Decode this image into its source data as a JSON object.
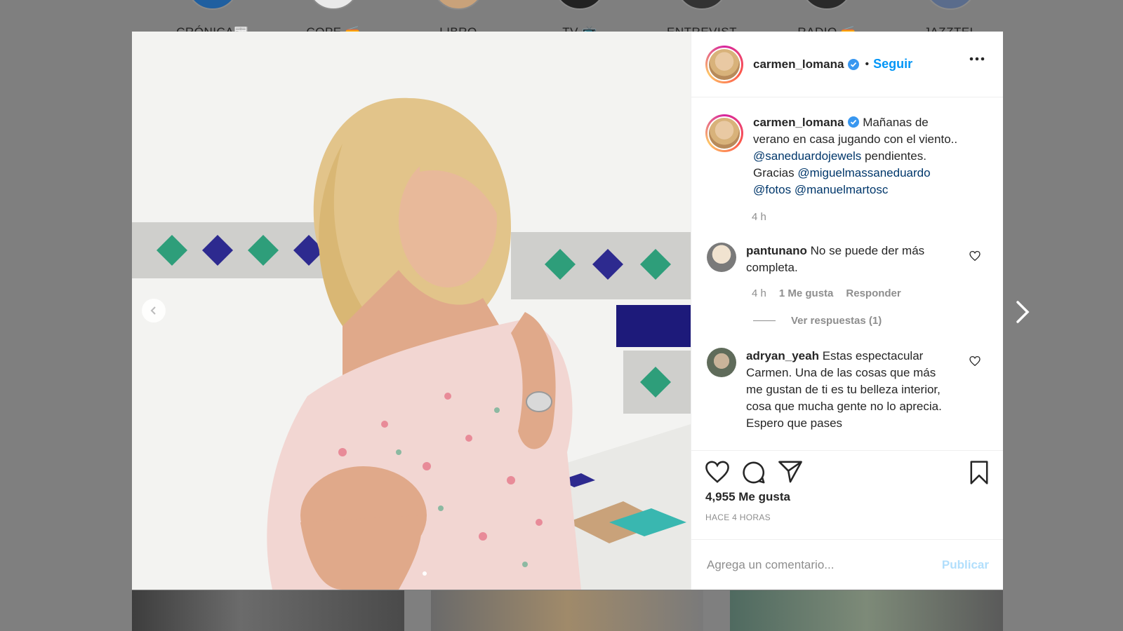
{
  "highlights": [
    {
      "label": "CRÓNICA📰"
    },
    {
      "label": "COPE 📻"
    },
    {
      "label": "LIBRO"
    },
    {
      "label": "TV 📺"
    },
    {
      "label": "ENTREVIST"
    },
    {
      "label": "RADIO 📻"
    },
    {
      "label": "JAZZTEL"
    }
  ],
  "post": {
    "username": "carmen_lomana",
    "follow_label": "Seguir",
    "bullet": "•",
    "caption": {
      "username": "carmen_lomana",
      "text_1": "Mañanas de verano en casa jugando con el viento..",
      "mention_1": "@saneduardojewels",
      "text_2": "pendientes. Gracias",
      "mention_2": "@miguelmassaneduardo",
      "mention_3": "@fotos",
      "mention_4": "@manuelmartosc",
      "time": "4 h"
    },
    "comments": [
      {
        "username": "pantunano",
        "text": "No se puede der más completa.",
        "time": "4 h",
        "likes": "1 Me gusta",
        "reply": "Responder",
        "view_replies": "Ver respuestas (1)"
      },
      {
        "username": "adryan_yeah",
        "text": "Estas espectacular Carmen. Una de las cosas que más me gustan de ti es tu belleza interior, cosa que mucha gente no lo aprecia. Espero que pases"
      }
    ],
    "likes": "4,955 Me gusta",
    "posted_ago": "HACE 4 HORAS",
    "add_comment_placeholder": "Agrega un comentario...",
    "publish_label": "Publicar"
  },
  "colors": {
    "link": "#0095f6",
    "mention": "#00376b",
    "overlay": "#7f7f7f"
  }
}
